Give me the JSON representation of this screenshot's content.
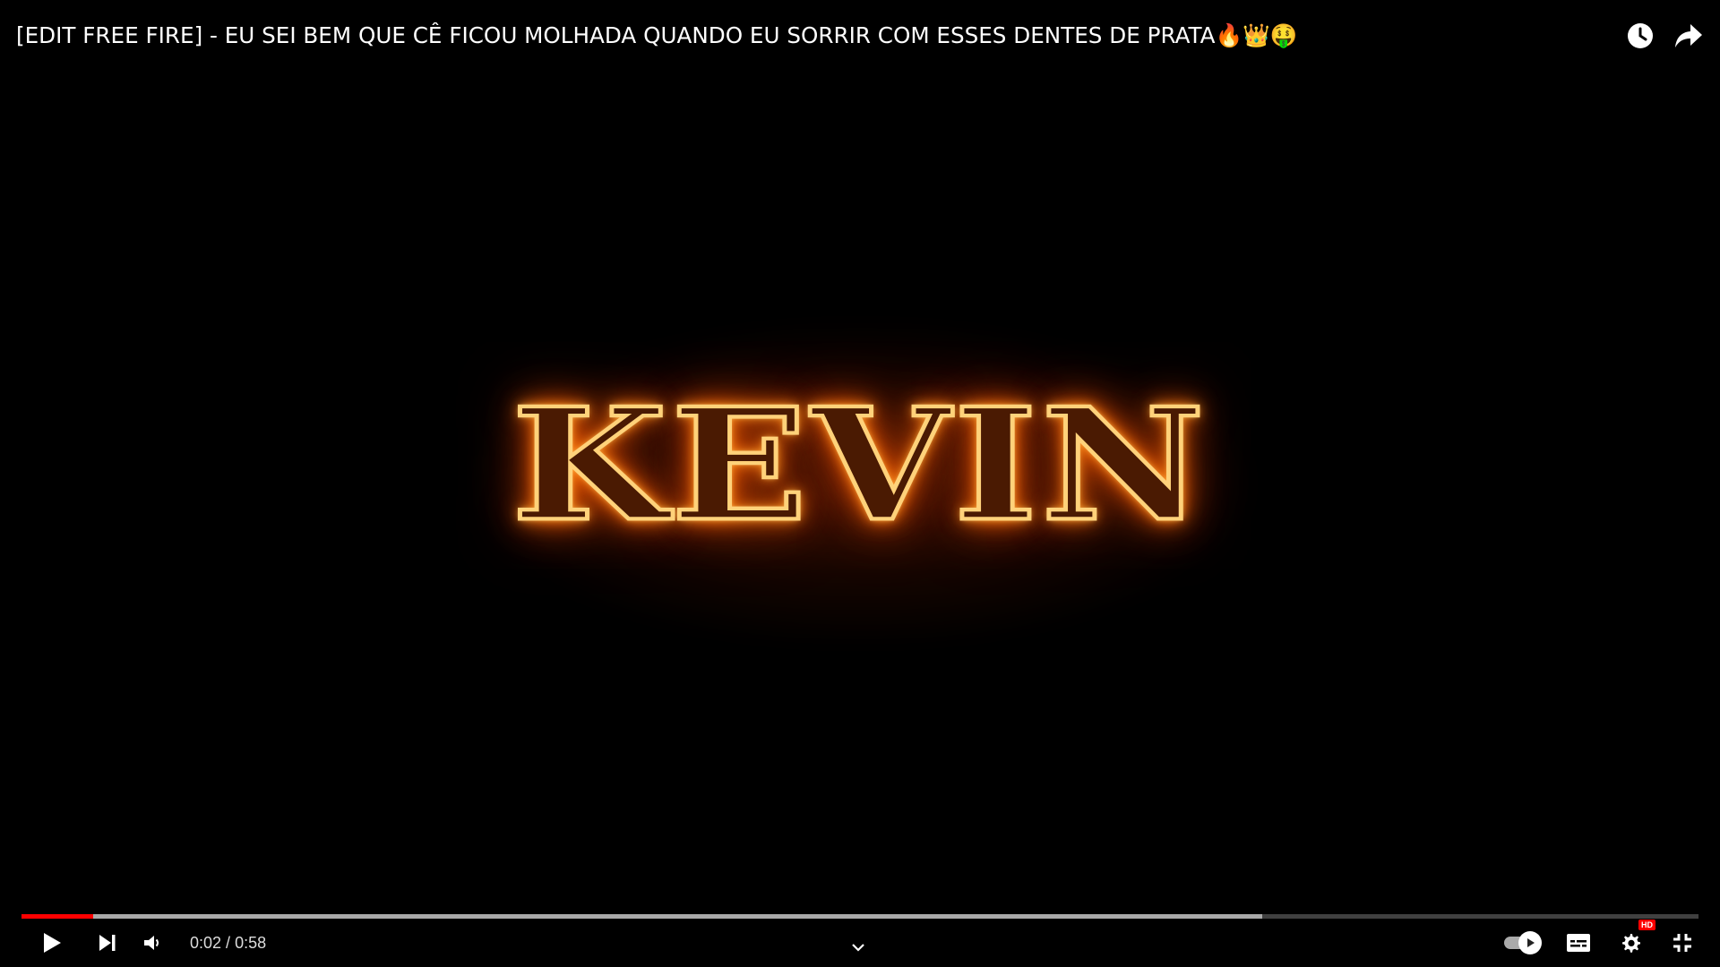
{
  "video": {
    "title": "[EDIT FREE FIRE] - EU SEI BEM QUE CÊ FICOU MOLHADA QUANDO EU SORRIR COM ESSES DENTES DE PRATA🔥👑🤑",
    "overlay_text": "KEVIN"
  },
  "top_actions": {
    "watch_later_icon": "clock-icon",
    "share_icon": "share-arrow-icon"
  },
  "progress": {
    "played_fraction": 0.043,
    "loaded_fraction": 0.74,
    "played_color": "#ff0000"
  },
  "controls": {
    "current_time": "0:02",
    "separator": " / ",
    "duration": "0:58",
    "play_icon": "play-icon",
    "next_icon": "next-icon",
    "volume_icon": "volume-icon",
    "chevron_icon": "chevron-down-icon",
    "autoplay_icon": "autoplay-toggle-icon",
    "subtitles_icon": "subtitles-icon",
    "settings_icon": "gear-icon",
    "settings_badge": "HD",
    "fullscreen_exit_icon": "exit-fullscreen-icon"
  }
}
